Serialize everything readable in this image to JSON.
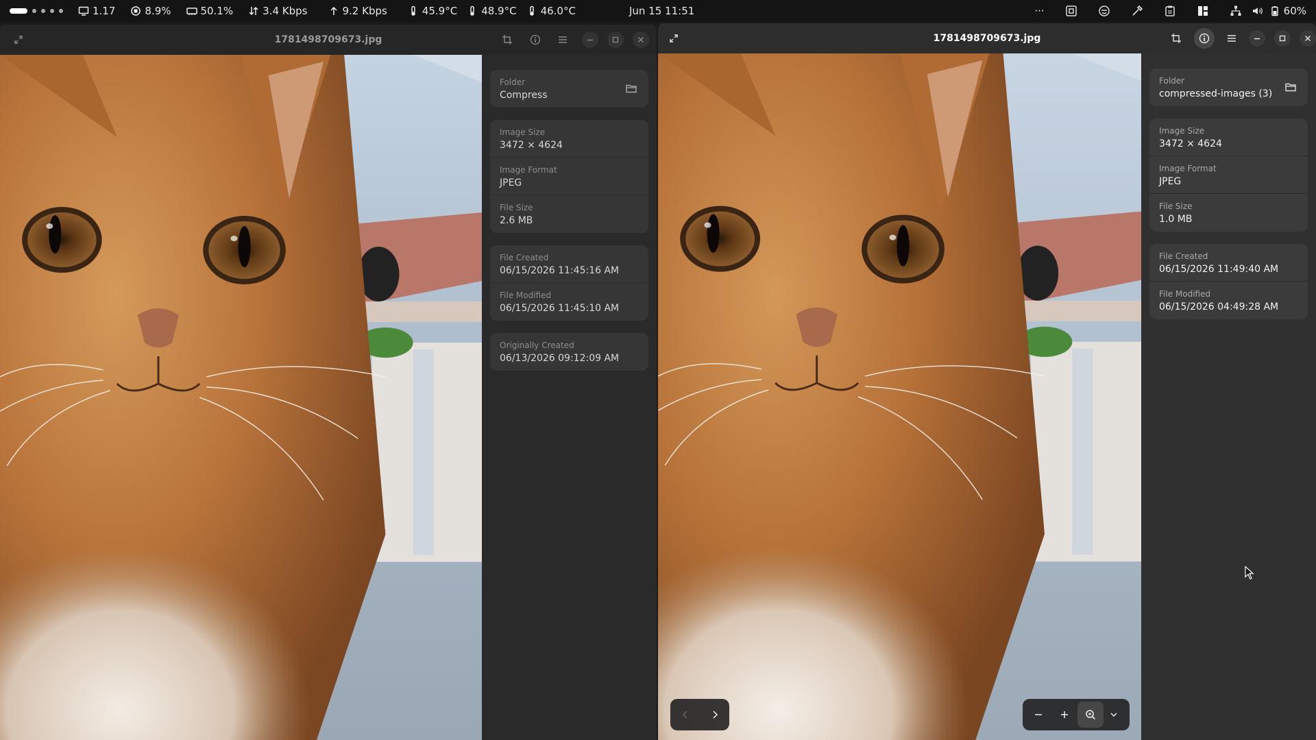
{
  "topbar": {
    "stats": [
      {
        "icon": "monitor-icon",
        "value": "1.17"
      },
      {
        "icon": "cpu-icon",
        "value": "8.9%"
      },
      {
        "icon": "memory-icon",
        "value": "50.1%"
      },
      {
        "icon": "download-icon",
        "value": "3.4 Kbps"
      },
      {
        "icon": "upload-icon",
        "value": "9.2 Kbps"
      },
      {
        "icon": "thermometer-icon",
        "value": "45.9°C"
      },
      {
        "icon": "thermometer-icon",
        "value": "48.9°C"
      },
      {
        "icon": "thermometer-icon",
        "value": "46.0°C"
      }
    ],
    "clock": "Jun 15  11:51",
    "battery": "60%",
    "overflow": "···"
  },
  "left_window": {
    "title": "1781498709673.jpg",
    "groups": [
      [
        {
          "label": "Folder",
          "value": "Compress",
          "folder_button": true
        }
      ],
      [
        {
          "label": "Image Size",
          "value": "3472 × 4624"
        },
        {
          "label": "Image Format",
          "value": "JPEG"
        },
        {
          "label": "File Size",
          "value": "2.6 MB"
        }
      ],
      [
        {
          "label": "File Created",
          "value": "06/15/2026 11:45:16 AM"
        },
        {
          "label": "File Modified",
          "value": "06/15/2026 11:45:10 AM"
        }
      ],
      [
        {
          "label": "Originally Created",
          "value": "06/13/2026 09:12:09 AM"
        }
      ]
    ]
  },
  "right_window": {
    "title": "1781498709673.jpg",
    "groups": [
      [
        {
          "label": "Folder",
          "value": "compressed-images (3)",
          "folder_button": true
        }
      ],
      [
        {
          "label": "Image Size",
          "value": "3472 × 4624"
        },
        {
          "label": "Image Format",
          "value": "JPEG"
        },
        {
          "label": "File Size",
          "value": "1.0 MB"
        }
      ],
      [
        {
          "label": "File Created",
          "value": "06/15/2026 11:49:40 AM"
        },
        {
          "label": "File Modified",
          "value": "06/15/2026 04:49:28 AM"
        }
      ]
    ]
  },
  "colors": {
    "fur": "#c07a3c",
    "background_blue": "#9fb5cc",
    "roof": "#b9776a"
  }
}
